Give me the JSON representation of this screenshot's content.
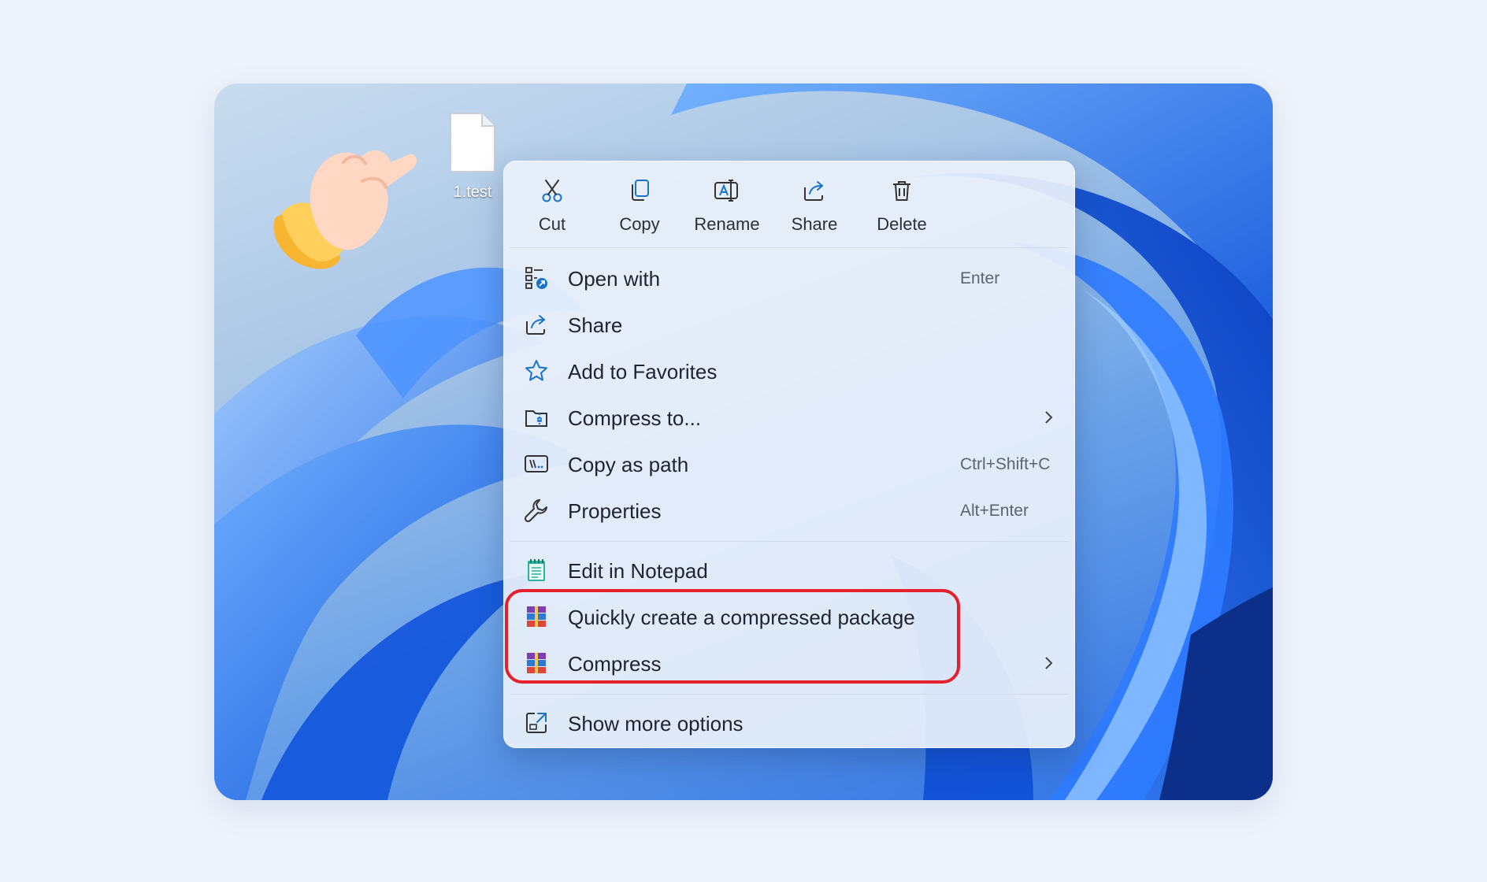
{
  "desktop": {
    "file_label": "1.test"
  },
  "context_menu": {
    "toolbar": [
      {
        "label": "Cut",
        "icon": "scissors-icon"
      },
      {
        "label": "Copy",
        "icon": "copy-icon"
      },
      {
        "label": "Rename",
        "icon": "rename-icon"
      },
      {
        "label": "Share",
        "icon": "share-icon"
      },
      {
        "label": "Delete",
        "icon": "trash-icon"
      }
    ],
    "items": [
      {
        "label": "Open with",
        "shortcut": "Enter",
        "icon": "open-with-icon"
      },
      {
        "label": "Share",
        "shortcut": "",
        "icon": "share-icon"
      },
      {
        "label": "Add to Favorites",
        "shortcut": "",
        "icon": "star-icon"
      },
      {
        "label": "Compress to...",
        "shortcut": "",
        "icon": "zip-folder-icon",
        "submenu": true
      },
      {
        "label": "Copy as path",
        "shortcut": "Ctrl+Shift+C",
        "icon": "path-icon"
      },
      {
        "label": "Properties",
        "shortcut": "Alt+Enter",
        "icon": "wrench-icon"
      },
      {
        "label": "Edit in Notepad",
        "shortcut": "",
        "icon": "notepad-icon"
      },
      {
        "label": "Quickly create a compressed package",
        "shortcut": "",
        "icon": "winrar-icon"
      },
      {
        "label": "Compress",
        "shortcut": "",
        "icon": "winrar-icon",
        "submenu": true
      },
      {
        "label": "Show more options",
        "shortcut": "",
        "icon": "more-options-icon"
      }
    ]
  },
  "colors": {
    "highlight_border": "#e3202b",
    "menu_background": "#eaf0fa",
    "icon_accent": "#1a73c9"
  }
}
